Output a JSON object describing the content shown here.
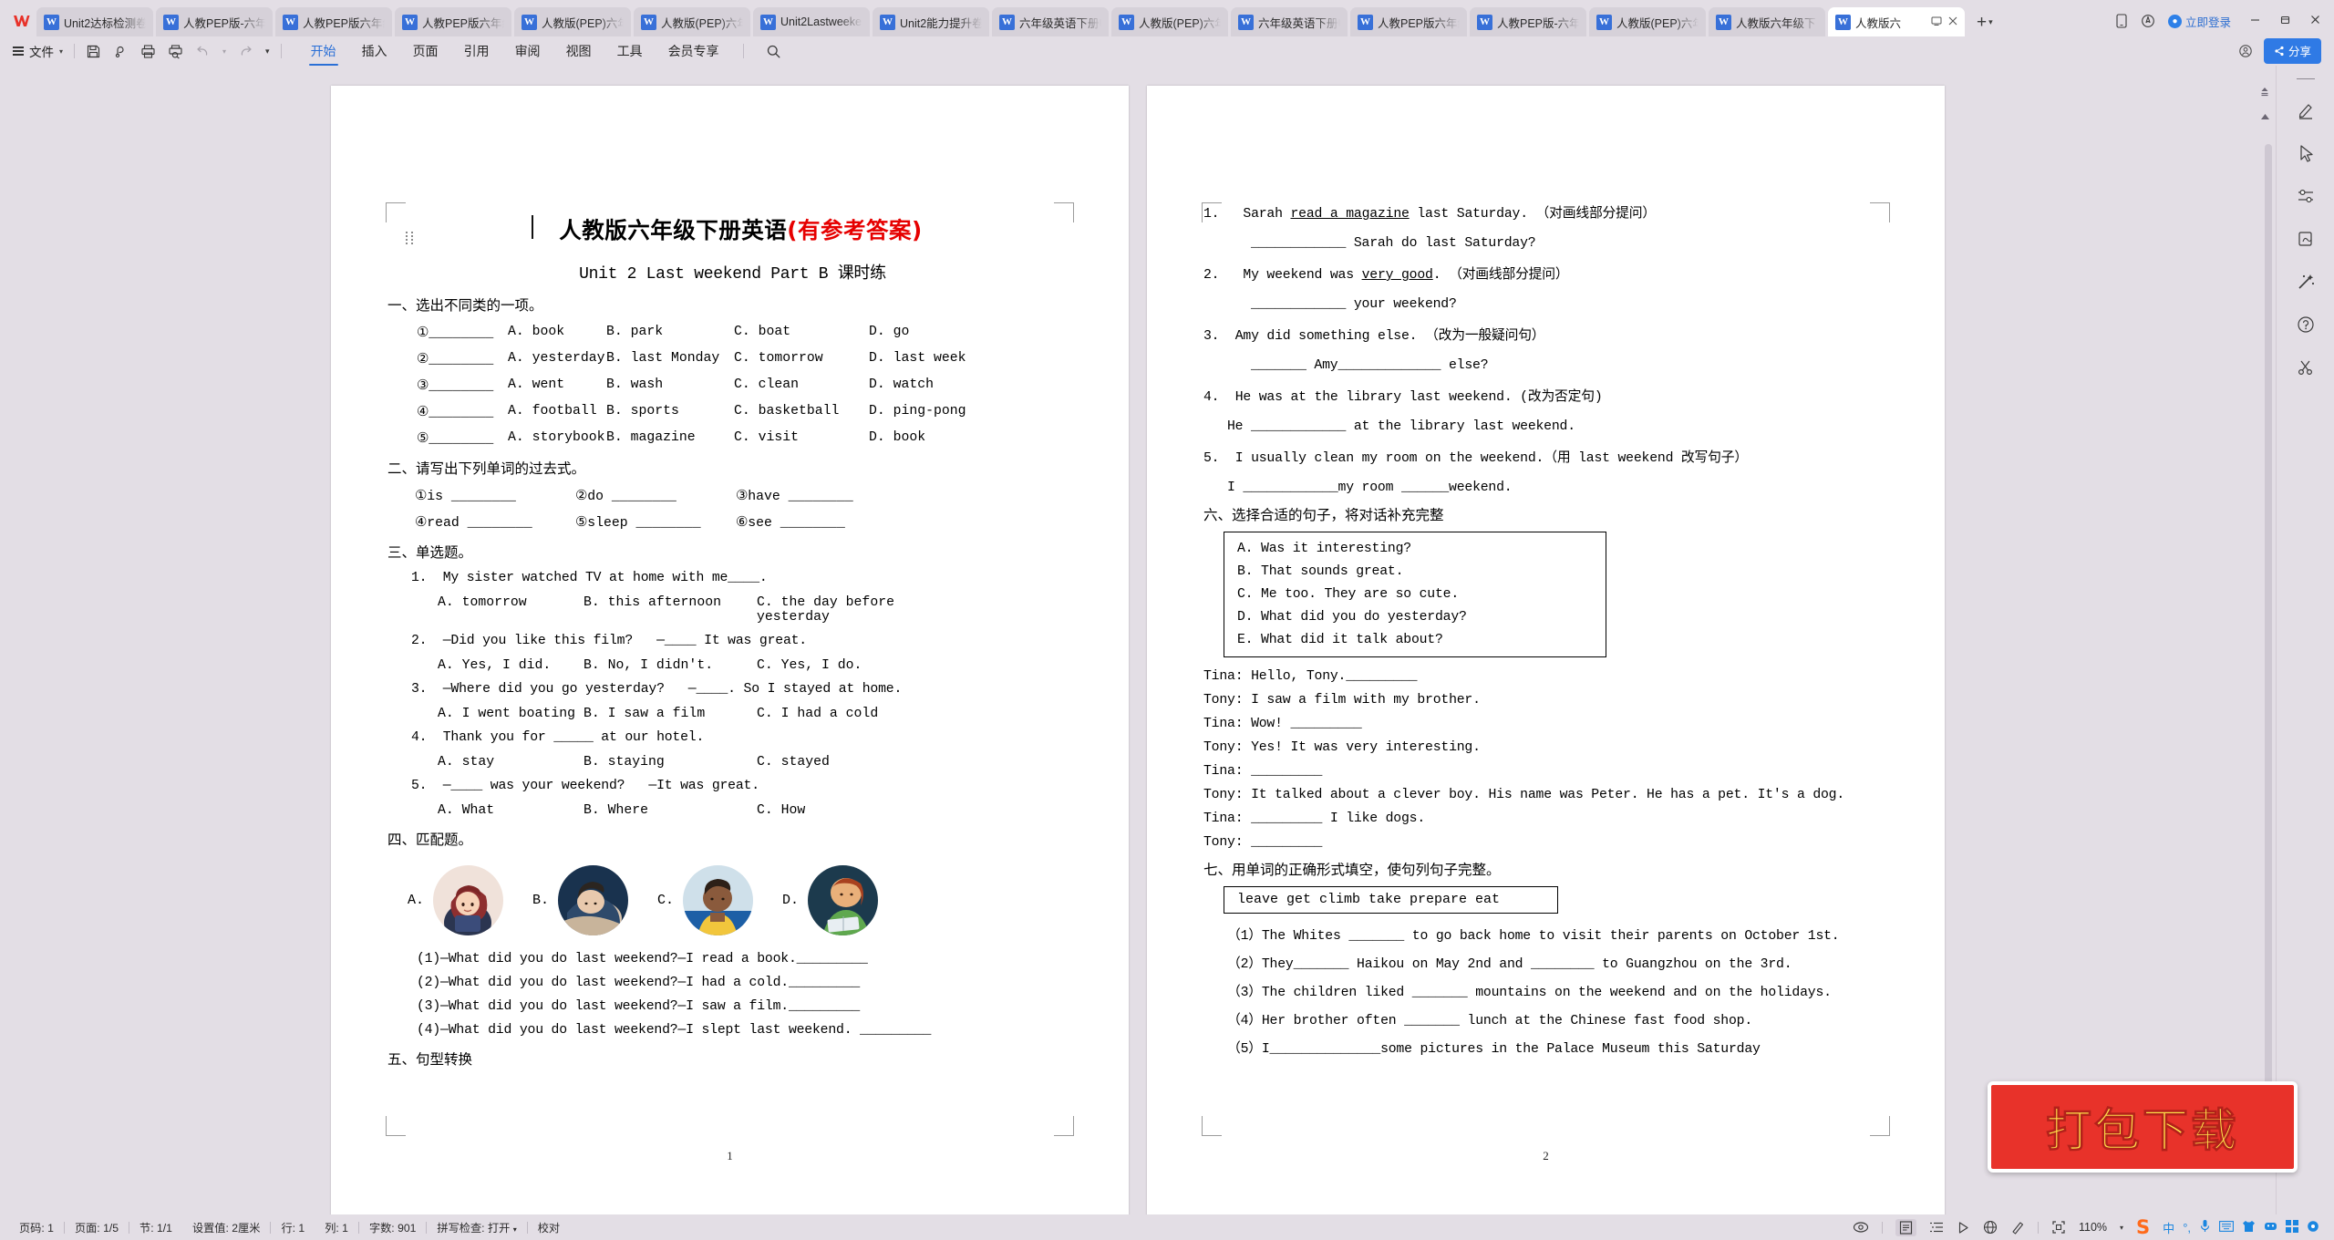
{
  "app": {
    "name": "WPS Office",
    "logo_letter": "W"
  },
  "tabbar": {
    "tabs": [
      {
        "label": "Unit2达标检测卷",
        "active": false
      },
      {
        "label": "人教PEP版-六年级",
        "active": false
      },
      {
        "label": "人教PEP版六年级",
        "active": false
      },
      {
        "label": "人教PEP版六年级",
        "active": false
      },
      {
        "label": "人教版(PEP)六年",
        "active": false
      },
      {
        "label": "人教版(PEP)六年",
        "active": false
      },
      {
        "label": "Unit2Lastweeke",
        "active": false
      },
      {
        "label": "Unit2能力提升卷",
        "active": false
      },
      {
        "label": "六年级英语下册U",
        "active": false
      },
      {
        "label": "人教版(PEP)六年",
        "active": false
      },
      {
        "label": "六年级英语下册U",
        "active": false
      },
      {
        "label": "人教PEP版六年级",
        "active": false
      },
      {
        "label": "人教PEP版-六年",
        "active": false
      },
      {
        "label": "人教版(PEP)六年",
        "active": false
      },
      {
        "label": "人教版六年级下",
        "active": false
      },
      {
        "label": "人教版六",
        "active": true
      }
    ],
    "new_tab_label": "+",
    "login_label": "立即登录",
    "window_minimize": "—",
    "window_restore": "❐",
    "window_close": "✕"
  },
  "ribbon": {
    "file_label": "文件",
    "quick_icons": [
      "save-icon",
      "cloud-sync-icon",
      "print-icon",
      "print-preview-icon",
      "undo-icon",
      "redo-icon",
      "customize-icon"
    ],
    "tabs": [
      {
        "label": "开始",
        "selected": true
      },
      {
        "label": "插入",
        "selected": false
      },
      {
        "label": "页面",
        "selected": false
      },
      {
        "label": "引用",
        "selected": false
      },
      {
        "label": "审阅",
        "selected": false
      },
      {
        "label": "视图",
        "selected": false
      },
      {
        "label": "工具",
        "selected": false
      },
      {
        "label": "会员专享",
        "selected": false
      }
    ],
    "share_label": "分享"
  },
  "document": {
    "title_black": "人教版六年级下册英语",
    "title_red": "(有参考答案)",
    "subtitle": "Unit 2 Last  weekend Part B 课时练",
    "page1_number": "1",
    "page2_number": "2",
    "section1": {
      "heading": "一、选出不同类的一项。",
      "rows": [
        {
          "num": "①________",
          "a": "A. book",
          "b": "B. park",
          "c": "C. boat",
          "d": "D. go"
        },
        {
          "num": "②________",
          "a": "A. yesterday",
          "b": "B. last Monday",
          "c": "C. tomorrow",
          "d": "D. last week"
        },
        {
          "num": "③________",
          "a": "A. went",
          "b": "B. wash",
          "c": "C. clean",
          "d": "D. watch"
        },
        {
          "num": "④________",
          "a": "A. football",
          "b": "B. sports",
          "c": "C. basketball",
          "d": "D. ping-pong"
        },
        {
          "num": "⑤________",
          "a": "A. storybook",
          "b": "B. magazine",
          "c": "C. visit",
          "d": "D. book"
        }
      ]
    },
    "section2": {
      "heading": "二、请写出下列单词的过去式。",
      "row1": [
        "①is ________",
        "②do ________",
        "③have ________"
      ],
      "row2": [
        "④read ________",
        "⑤sleep ________",
        "⑥see ________"
      ]
    },
    "section3": {
      "heading": "三、单选题。",
      "items": [
        {
          "q": "1.  My sister watched TV at home with me____.",
          "opts": [
            "A. tomorrow",
            "B. this afternoon",
            "C. the day before yesterday"
          ]
        },
        {
          "q": "2.  —Did you like this film?   —____ It was great.",
          "opts": [
            "A. Yes, I did.",
            "B. No, I didn't.",
            "C. Yes, I do."
          ]
        },
        {
          "q": "3.  —Where did you go yesterday?   —____. So I stayed at home.",
          "opts": [
            "A. I went boating",
            "B. I saw a film",
            "C. I had a cold"
          ]
        },
        {
          "q": "4.  Thank you for _____ at our hotel.",
          "opts": [
            "A. stay",
            "B. staying",
            "C. stayed"
          ]
        },
        {
          "q": "5.  —____ was your weekend?   —It was great.",
          "opts": [
            "A. What",
            "B. Where",
            "C. How"
          ]
        }
      ]
    },
    "section4": {
      "heading": "四、匹配题。",
      "labels": [
        "A.",
        "B.",
        "C.",
        "D."
      ],
      "questions": [
        "(1)—What did you do last weekend?—I read a book._________",
        "(2)—What did you do last weekend?—I had a cold._________",
        "(3)—What did you do last weekend?—I saw a film._________",
        "(4)—What did you do last weekend?—I slept last weekend. _________"
      ]
    },
    "section5": {
      "heading": "五、句型转换",
      "items": [
        {
          "q": "1.   Sarah read a magazine last Saturday. （对画线部分提问）",
          "q_pre": "1.   Sarah ",
          "q_ul": "read a magazine",
          "q_post": " last Saturday. （对画线部分提问）",
          "a": "____________ Sarah do last Saturday?"
        },
        {
          "q_pre": "2.   My weekend was ",
          "q_ul": "very good",
          "q_post": ". （对画线部分提问）",
          "a": "____________ your weekend?"
        },
        {
          "q_pre": "3.  Amy did something else. （改为一般疑问句）",
          "q_ul": "",
          "q_post": "",
          "a": "_______ Amy_____________ else?"
        },
        {
          "q_pre": "4.  He was at the library last weekend. (改为否定句)",
          "q_ul": "",
          "q_post": "",
          "a": "He ____________ at the library last weekend."
        },
        {
          "q_pre": "5.  I usually clean my room on the weekend.（用 last weekend 改写句子）",
          "q_ul": "",
          "q_post": "",
          "a": "I ____________my room ______weekend."
        }
      ]
    },
    "section6": {
      "heading": "六、选择合适的句子，将对话补充完整",
      "options": [
        "A. Was it interesting?",
        "B. That sounds great.",
        "C. Me too. They are so cute.",
        "D. What did you do yesterday?",
        "E. What did it talk about?"
      ],
      "dialogue": [
        "Tina: Hello, Tony._________",
        "Tony: I saw a film with my brother.",
        "Tina: Wow! _________",
        "Tony: Yes! It was very interesting.",
        "Tina: _________",
        "Tony: It talked about a clever boy. His name was Peter. He has a pet. It's a dog.",
        "Tina: _________ I like dogs.",
        "Tony: _________"
      ]
    },
    "section7": {
      "heading": "七、用单词的正确形式填空，使句列句子完整。",
      "wordbank": "leave   get   climb   take   prepare   eat",
      "items": [
        "（1）The Whites _______ to go back home to visit their parents on October 1st.",
        "（2）They_______ Haikou on May 2nd and ________ to Guangzhou on the 3rd.",
        "（3）The children liked _______ mountains on the weekend and on the holidays.",
        "（4）Her brother often _______ lunch at the Chinese fast food shop.",
        "（5）I______________some pictures in the Palace Museum this Saturday"
      ],
      "item2_ul": "Haikou"
    }
  },
  "sticker": {
    "label": "打包下载"
  },
  "statusbar": {
    "left_items": [
      "页码: 1",
      "页面: 1/5",
      "节: 1/1",
      "设置值: 2厘米",
      "行: 1",
      "列: 1",
      "字数: 901",
      "拼写检查: 打开",
      "校对"
    ],
    "zoom": "110%",
    "view_icons": [
      "eye-icon",
      "page-view-icon",
      "outline-view-icon",
      "play-icon",
      "web-view-icon",
      "brush-icon",
      "fullscreen-icon"
    ],
    "ime_label": "中"
  },
  "sidebar": {
    "icons": [
      "pen-icon",
      "cursor-icon",
      "settings-slider-icon",
      "hand-write-icon",
      "magic-wand-icon",
      "help-icon"
    ]
  },
  "colors": {
    "accent": "#2f7ae5",
    "chrome": "#e3dee5",
    "tab_active": "#ffffff",
    "title_red": "#e60000",
    "sticker_bg": "#e8322a",
    "sticker_text": "#ffe24b"
  }
}
